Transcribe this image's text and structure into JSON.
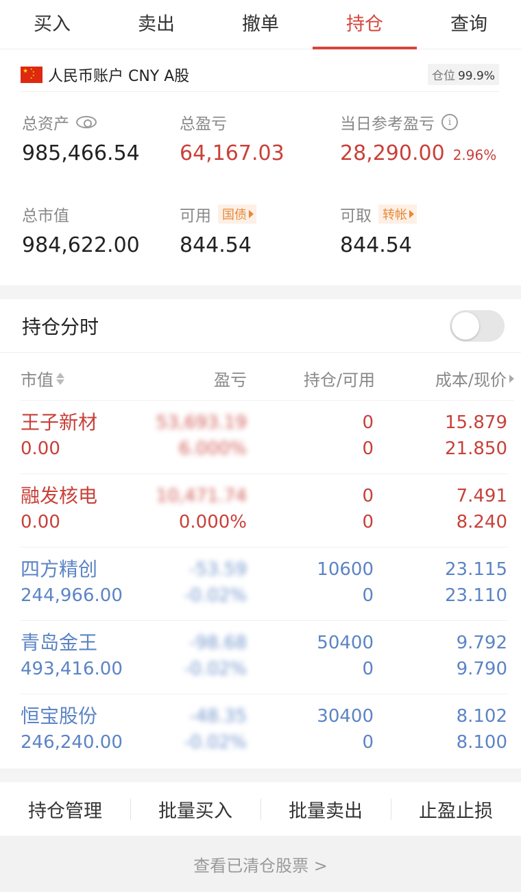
{
  "tabs": [
    {
      "label": "买入",
      "active": false
    },
    {
      "label": "卖出",
      "active": false
    },
    {
      "label": "撤单",
      "active": false
    },
    {
      "label": "持仓",
      "active": true
    },
    {
      "label": "查询",
      "active": false
    }
  ],
  "account": {
    "label": "人民币账户 CNY A股",
    "position_label": "仓位",
    "position_value": "99.9%"
  },
  "summary": {
    "total_assets_label": "总资产",
    "total_assets": "985,466.54",
    "total_pl_label": "总盈亏",
    "total_pl": "64,167.03",
    "daily_pl_label": "当日参考盈亏",
    "daily_pl": "28,290.00",
    "daily_pl_pct": "2.96%",
    "market_value_label": "总市值",
    "market_value": "984,622.00",
    "available_label": "可用",
    "available_tag": "国债",
    "available": "844.54",
    "withdrawable_label": "可取",
    "withdrawable_tag": "转帐",
    "withdrawable": "844.54"
  },
  "timeshare": {
    "label": "持仓分时",
    "enabled": false
  },
  "table": {
    "headers": {
      "market_value": "市值",
      "pl": "盈亏",
      "holding": "持仓/可用",
      "price": "成本/现价"
    },
    "rows": [
      {
        "name": "王子新材",
        "market_value": "0.00",
        "pl": "53,693.19",
        "pl_pct": "6.000%",
        "holding": "0",
        "available": "0",
        "cost": "15.879",
        "price": "21.850",
        "color": "red",
        "pl_blurred": true,
        "pct_blurred": true
      },
      {
        "name": "融发核电",
        "market_value": "0.00",
        "pl": "10,471.74",
        "pl_pct": "0.000%",
        "holding": "0",
        "available": "0",
        "cost": "7.491",
        "price": "8.240",
        "color": "red",
        "pl_blurred": true,
        "pct_blurred": false
      },
      {
        "name": "四方精创",
        "market_value": "244,966.00",
        "pl": "-53.59",
        "pl_pct": "-0.02%",
        "holding": "10600",
        "available": "0",
        "cost": "23.115",
        "price": "23.110",
        "color": "blue",
        "pl_blurred": true,
        "pct_blurred": true
      },
      {
        "name": "青岛金王",
        "market_value": "493,416.00",
        "pl": "-98.68",
        "pl_pct": "-0.02%",
        "holding": "50400",
        "available": "0",
        "cost": "9.792",
        "price": "9.790",
        "color": "blue",
        "pl_blurred": true,
        "pct_blurred": true
      },
      {
        "name": "恒宝股份",
        "market_value": "246,240.00",
        "pl": "-48.35",
        "pl_pct": "-0.02%",
        "holding": "30400",
        "available": "0",
        "cost": "8.102",
        "price": "8.100",
        "color": "blue",
        "pl_blurred": true,
        "pct_blurred": true
      }
    ]
  },
  "actions": [
    "持仓管理",
    "批量买入",
    "批量卖出",
    "止盈止损"
  ],
  "footer": {
    "label": "查看已清仓股票 >"
  },
  "colors": {
    "accent": "#d6453c",
    "up": "#c8413a",
    "down": "#5c84c4",
    "tag": "#e58a3a"
  }
}
